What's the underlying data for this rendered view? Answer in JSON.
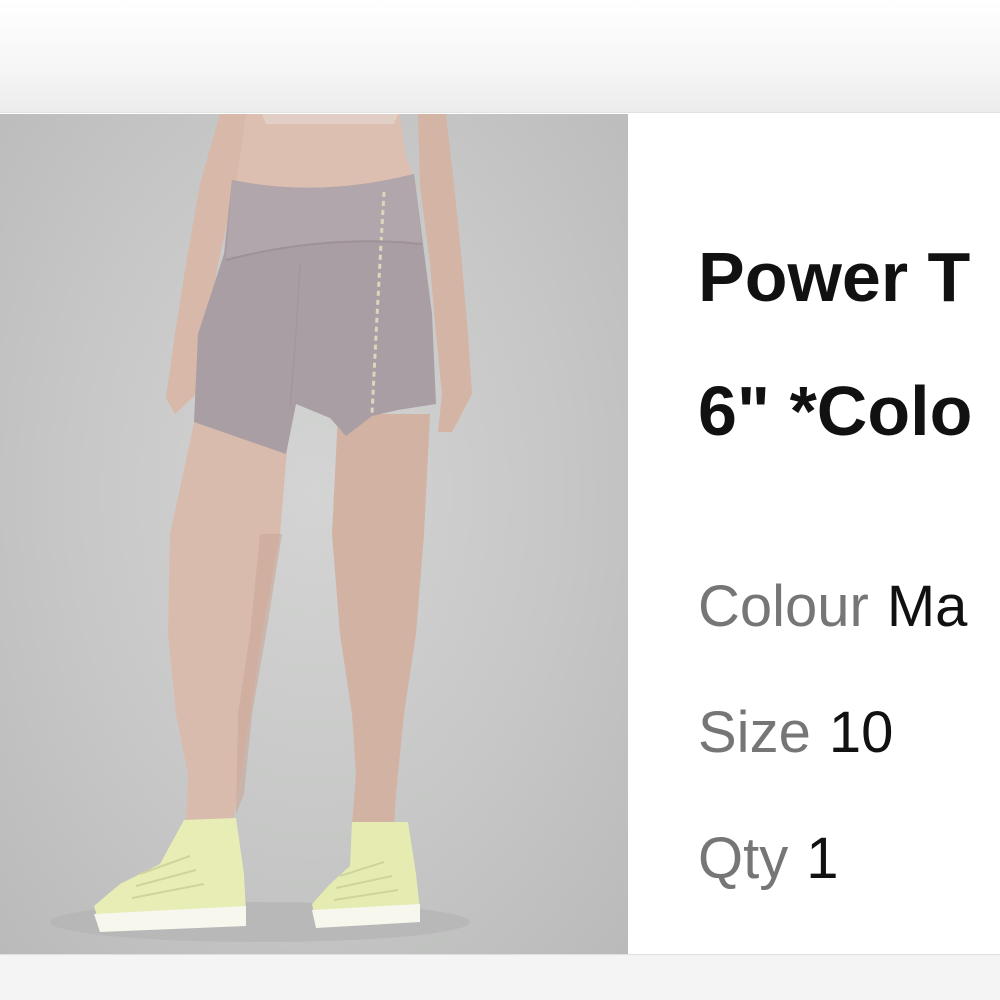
{
  "product": {
    "title_line1": "Power T",
    "title_line2": "6\" *Colo"
  },
  "attributes": {
    "colour": {
      "label": "Colour",
      "value": "Ma"
    },
    "size": {
      "label": "Size",
      "value": "10"
    },
    "qty": {
      "label": "Qty",
      "value": "1"
    }
  },
  "colors": {
    "photo_background": "#c6c7c6",
    "shorts": "#a99ea3",
    "shoes": "#e8edb6",
    "label_gray": "#767676",
    "text_dark": "#111111"
  }
}
